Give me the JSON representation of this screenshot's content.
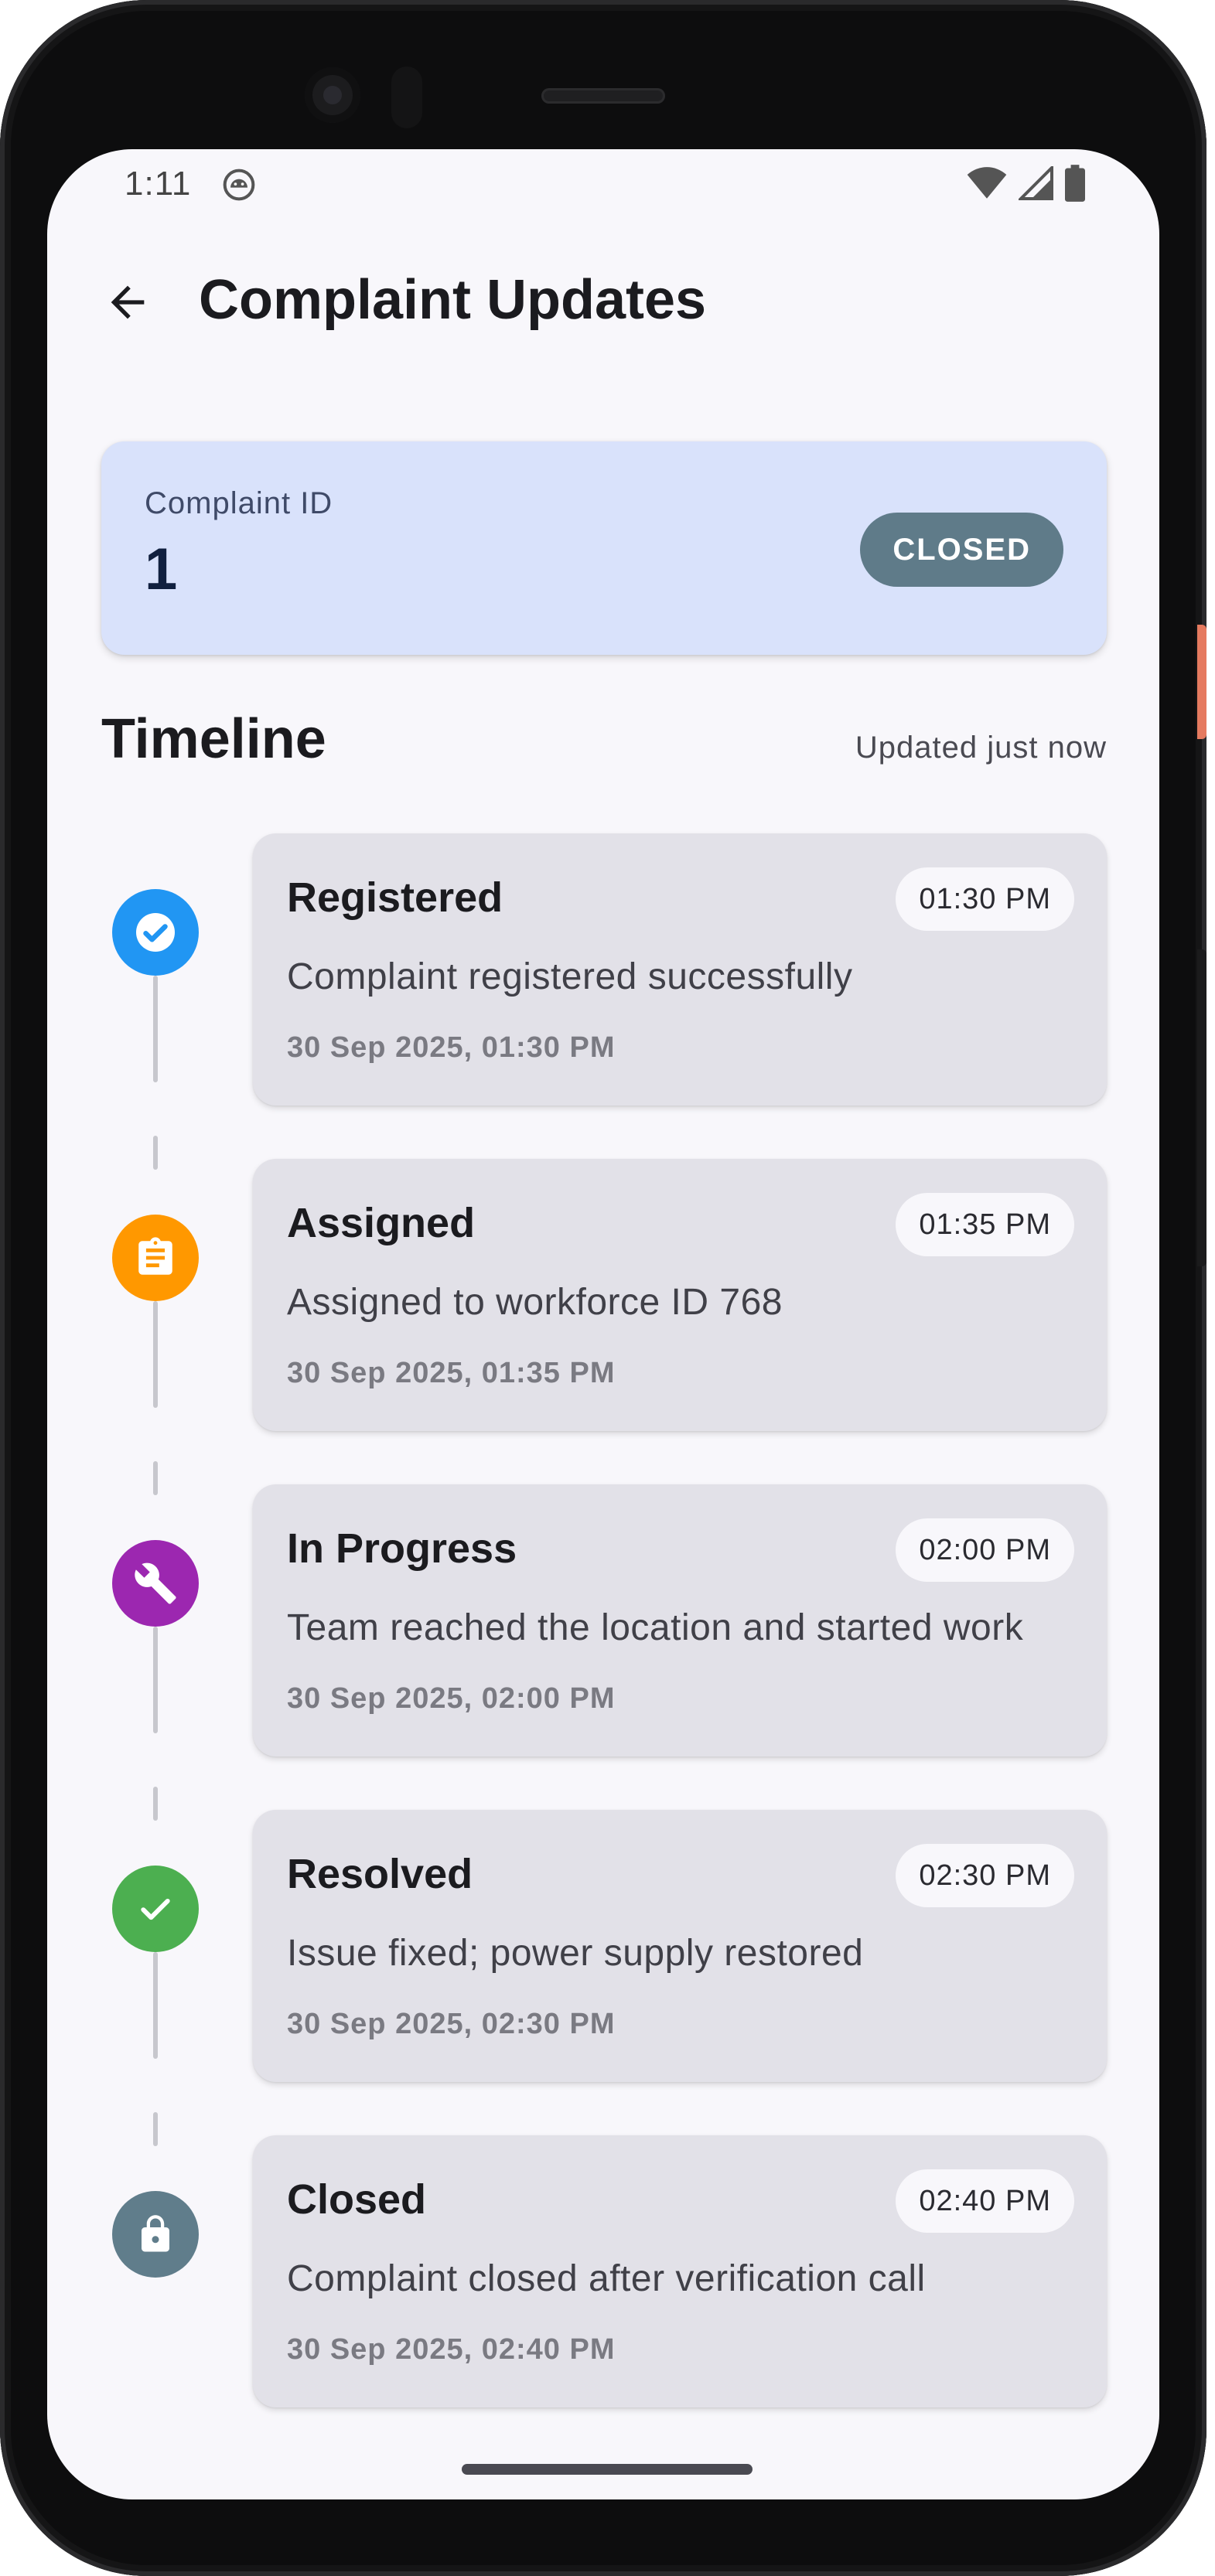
{
  "status_bar": {
    "time": "1:11",
    "icons": [
      "android-debug-icon",
      "wifi-icon",
      "signal-icon",
      "battery-icon"
    ]
  },
  "app_bar": {
    "title": "Complaint Updates",
    "back_icon": "arrow-back-icon"
  },
  "complaint": {
    "id_label": "Complaint ID",
    "id_value": "1",
    "status": "CLOSED",
    "status_color": "#5f7b89"
  },
  "timeline": {
    "title": "Timeline",
    "updated": "Updated just now",
    "events": [
      {
        "title": "Registered",
        "time": "01:30 PM",
        "description": "Complaint registered successfully",
        "timestamp": "30 Sep 2025, 01:30 PM",
        "icon": "check-circle-icon",
        "color": "#2196f3"
      },
      {
        "title": "Assigned",
        "time": "01:35 PM",
        "description": "Assigned to workforce ID 768",
        "timestamp": "30 Sep 2025, 01:35 PM",
        "icon": "clipboard-icon",
        "color": "#ff9800"
      },
      {
        "title": "In Progress",
        "time": "02:00 PM",
        "description": "Team reached the location and started work",
        "timestamp": "30 Sep 2025, 02:00 PM",
        "icon": "wrench-icon",
        "color": "#9c27b0"
      },
      {
        "title": "Resolved",
        "time": "02:30 PM",
        "description": "Issue fixed; power supply restored",
        "timestamp": "30 Sep 2025, 02:30 PM",
        "icon": "check-icon",
        "color": "#4caf50"
      },
      {
        "title": "Closed",
        "time": "02:40 PM",
        "description": "Complaint closed after verification call",
        "timestamp": "30 Sep 2025, 02:40 PM",
        "icon": "lock-icon",
        "color": "#607d8b"
      }
    ]
  }
}
